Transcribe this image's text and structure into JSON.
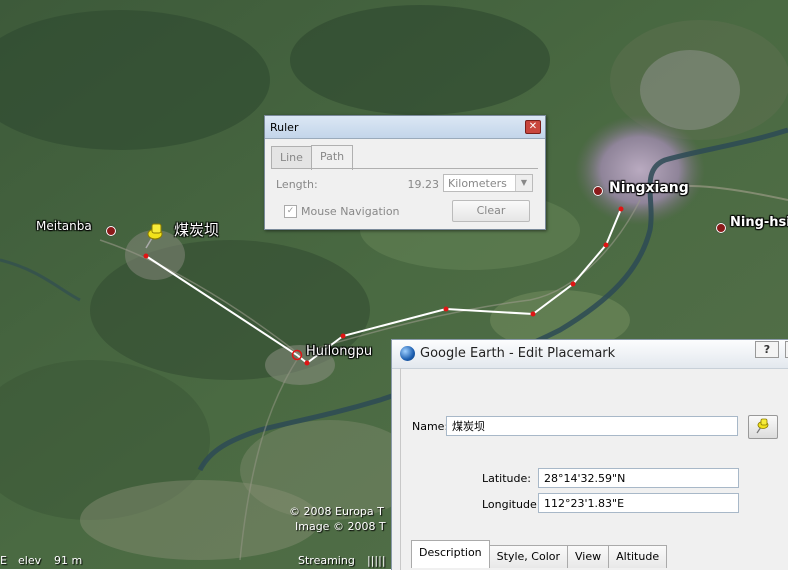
{
  "map": {
    "places": [
      {
        "name": "Meitanba"
      },
      {
        "name": "煤炭坝"
      },
      {
        "name": "Huilongpu"
      },
      {
        "name": "Ningxiang"
      },
      {
        "name": "Ning-hsi"
      }
    ],
    "credits": [
      "© 2008 Europa T",
      "Image © 2008 T"
    ],
    "status": {
      "elev_label": "elev",
      "elev_value": "91 m",
      "streaming": "Streaming",
      "bars": "|||||"
    },
    "path_color": "#ffffff"
  },
  "ruler": {
    "title": "Ruler",
    "close": "✕",
    "tabs": [
      {
        "label": "Line"
      },
      {
        "label": "Path"
      }
    ],
    "length_label": "Length:",
    "length_value": "19.23",
    "units": "Kilometers",
    "mouse_nav_label": "Mouse Navigation",
    "mouse_nav_checked": "✓",
    "clear_label": "Clear"
  },
  "edit_placemark": {
    "title": "Google Earth - Edit Placemark",
    "help": "?",
    "name_label": "Name:",
    "name_value": "煤炭坝",
    "latitude_label": "Latitude:",
    "latitude_value": "28°14'32.59\"N",
    "longitude_label": "Longitude:",
    "longitude_value": "112°23'1.83\"E",
    "tabs": [
      {
        "label": "Description"
      },
      {
        "label": "Style, Color"
      },
      {
        "label": "View"
      },
      {
        "label": "Altitude"
      }
    ]
  }
}
